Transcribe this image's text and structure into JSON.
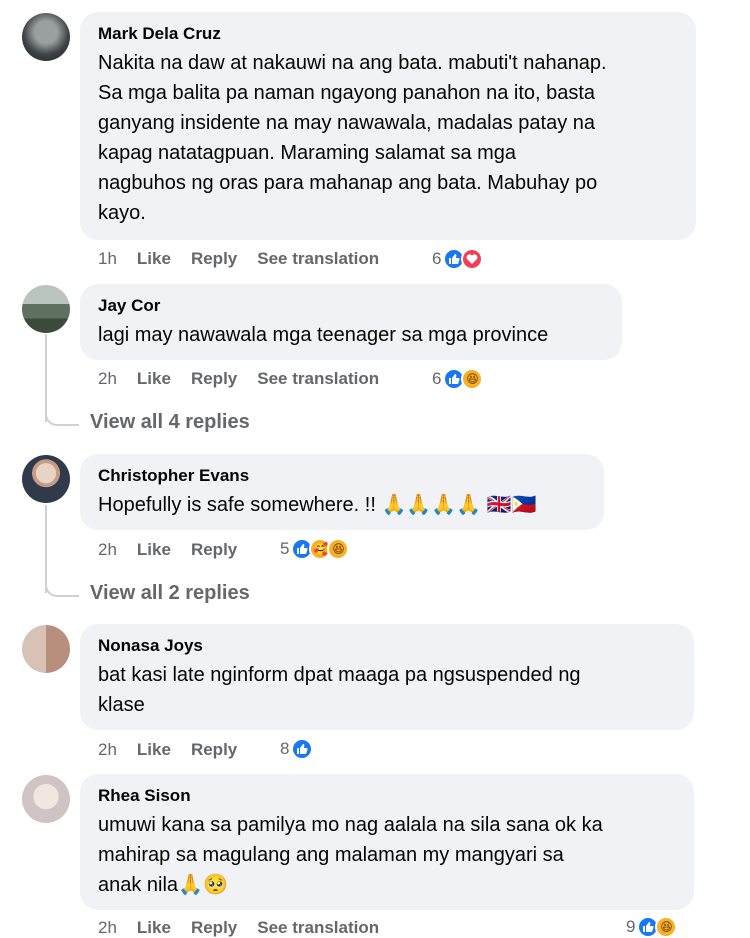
{
  "comments": [
    {
      "author": "Mark Dela Cruz",
      "text": "Nakita na daw at nakauwi na ang bata. mabuti't nahanap.\nSa mga balita pa naman ngayong panahon na ito, basta\nganyang insidente na may nawawala, madalas patay na\nkapag natatagpuan. Maraming salamat sa mga\nnagbuhos ng oras para mahanap ang bata. Mabuhay po\nkayo.",
      "time": "1h",
      "like": "Like",
      "reply": "Reply",
      "translate": "See translation",
      "reaction_count": "6"
    },
    {
      "author": "Jay Cor",
      "text": "lagi may nawawala mga teenager sa mga province",
      "time": "2h",
      "like": "Like",
      "reply": "Reply",
      "translate": "See translation",
      "reaction_count": "6",
      "view_replies": "View all 4 replies"
    },
    {
      "author": "Christopher Evans",
      "text": "Hopefully is safe somewhere. !! 🙏🙏🙏🙏 🇬🇧🇵🇭",
      "time": "2h",
      "like": "Like",
      "reply": "Reply",
      "reaction_count": "5",
      "view_replies": "View all 2 replies"
    },
    {
      "author": "Nonasa Joys",
      "text": "bat kasi late nginform dpat maaga pa ngsuspended ng\nklase",
      "time": "2h",
      "like": "Like",
      "reply": "Reply",
      "reaction_count": "8"
    },
    {
      "author": "Rhea Sison",
      "text": "umuwi kana sa pamilya mo nag aalala na sila sana ok ka\nmahirap sa magulang ang malaman my mangyari sa\nanak nila🙏🥺",
      "time": "2h",
      "like": "Like",
      "reply": "Reply",
      "translate": "See translation",
      "reaction_count": "9"
    }
  ],
  "icons": {
    "like": "thumbs-up-icon",
    "love": "heart-icon",
    "haha": "laughing-face-icon",
    "care": "care-face-icon"
  },
  "colors": {
    "bubble": "#f0f2f5",
    "meta_text": "#65676b",
    "like_blue": "#1877f2",
    "love_red": "#f33e58",
    "haha_yellow": "#f7b125"
  }
}
